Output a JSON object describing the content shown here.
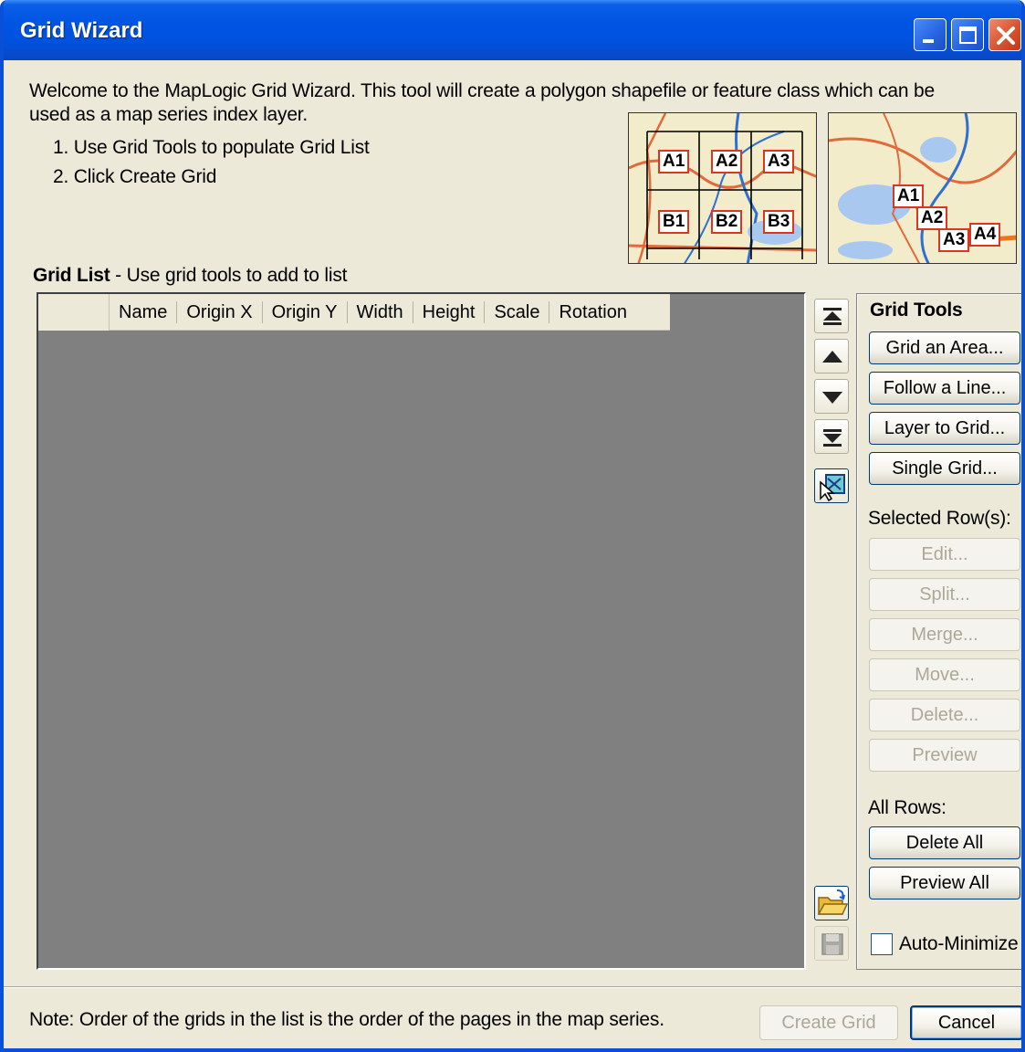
{
  "window": {
    "title": "Grid Wizard"
  },
  "intro": {
    "line1": "Welcome to the MapLogic Grid Wizard.  This tool will create a polygon shapefile or feature class which can be",
    "line2": "used as a map series index layer.",
    "steps": [
      "1. Use Grid Tools to populate Grid List",
      "2. Click Create Grid"
    ]
  },
  "thumbnails": {
    "area_labels": [
      "A1",
      "A2",
      "A3",
      "B1",
      "B2",
      "B3"
    ],
    "line_labels": [
      "A1",
      "A2",
      "A3",
      "A4"
    ]
  },
  "grid_list": {
    "title": "Grid List",
    "subtitle": " - Use grid tools to add to list",
    "columns": [
      "Name",
      "Origin X",
      "Origin Y",
      "Width",
      "Height",
      "Scale",
      "Rotation"
    ]
  },
  "side_icons": [
    "move-to-top-icon",
    "move-up-icon",
    "move-down-icon",
    "move-to-bottom-icon",
    "select-on-map-icon",
    "open-folder-icon",
    "save-icon"
  ],
  "grid_tools": {
    "title": "Grid Tools",
    "tool_buttons": [
      "Grid an Area...",
      "Follow a Line...",
      "Layer to Grid...",
      "Single Grid..."
    ],
    "selected_rows_label": "Selected Row(s):",
    "selected_buttons": [
      "Edit...",
      "Split...",
      "Merge...",
      "Move...",
      "Delete...",
      "Preview"
    ],
    "all_rows_label": "All Rows:",
    "all_buttons": [
      "Delete All",
      "Preview All"
    ],
    "auto_minimize_label": "Auto-Minimize"
  },
  "footer": {
    "note": "Note: Order of the grids in the list is the order of the pages in the map series.",
    "create_label": "Create Grid",
    "cancel_label": "Cancel"
  },
  "colors": {
    "titlebar": "#0054e3",
    "dialog_bg": "#ece9d8",
    "list_bg": "#808080",
    "grid_label_border": "#d9381e"
  }
}
